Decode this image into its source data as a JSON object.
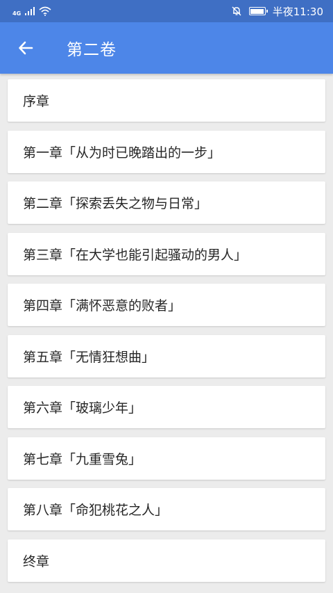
{
  "status_bar": {
    "network": "4G",
    "time": "半夜11:30",
    "icons": [
      "signal-icon",
      "wifi-icon",
      "mute-bell-icon",
      "battery-icon"
    ]
  },
  "app_bar": {
    "title": "第二卷",
    "back_icon": "arrow-left-icon",
    "background": "#4d86e8"
  },
  "chapters": [
    "序章",
    "第一章「从为时已晚踏出的一步」",
    "第二章「探索丢失之物与日常」",
    "第三章「在大学也能引起骚动的男人」",
    "第四章「满怀恶意的败者」",
    "第五章「无情狂想曲」",
    "第六章「玻璃少年」",
    "第七章「九重雪兔」",
    "第八章「命犯桃花之人」",
    "终章"
  ]
}
